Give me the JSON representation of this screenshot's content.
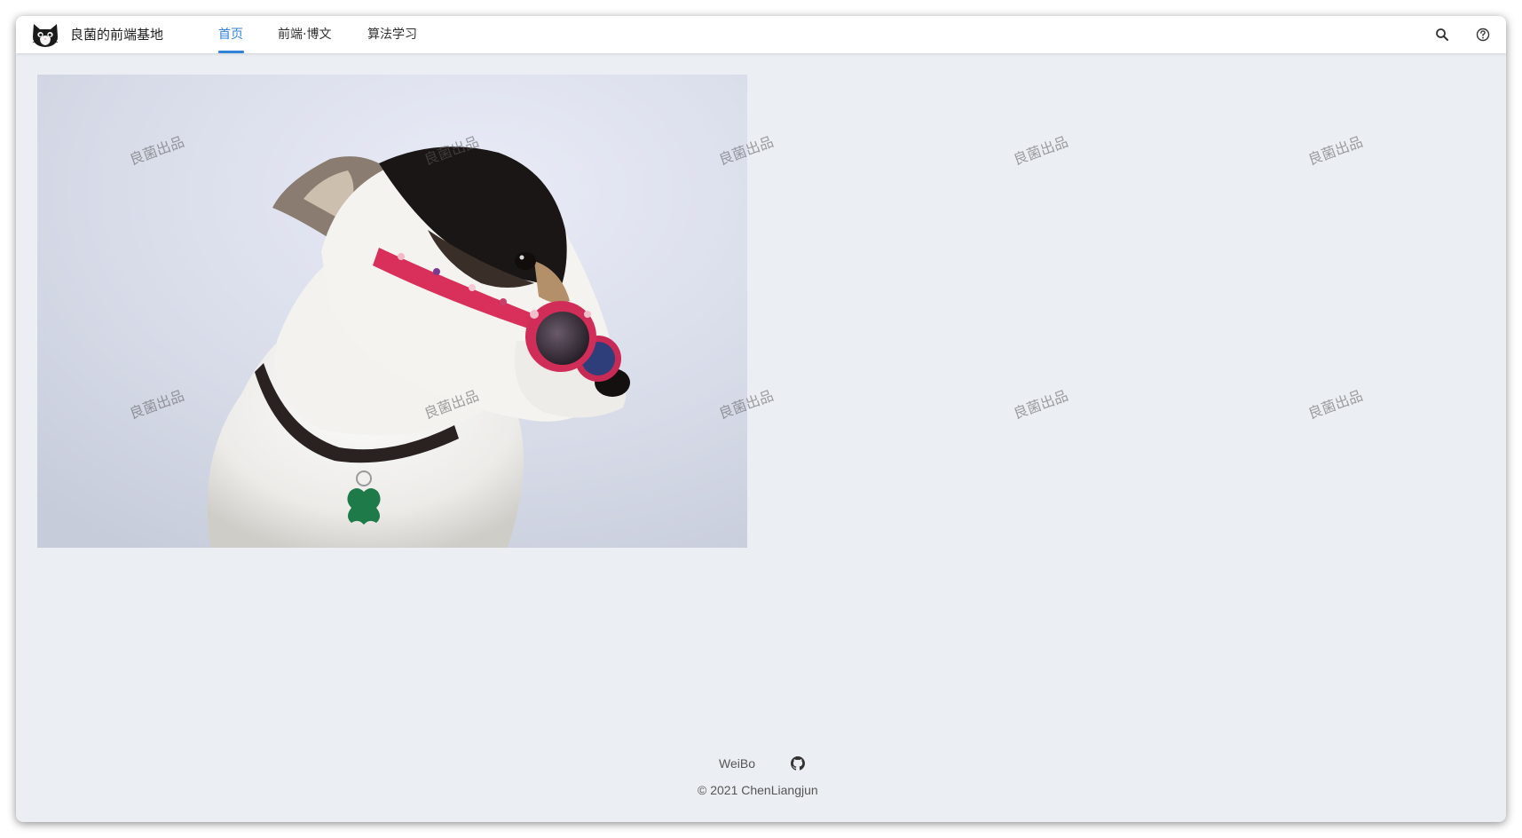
{
  "navbar": {
    "site_title": "良菌的前端基地",
    "logo_icon": "cat-logo-icon",
    "items": [
      {
        "label": "首页",
        "active": true
      },
      {
        "label": "前端·博文",
        "active": false
      },
      {
        "label": "算法学习",
        "active": false
      }
    ],
    "actions": [
      "search-icon",
      "help-icon"
    ],
    "accent": "#2f83d8"
  },
  "main": {
    "hero_image": "dog-wearing-sunglasses-photo",
    "watermark_text": "良菌出品"
  },
  "footer": {
    "link_weibo": "WeiBo",
    "github_icon": "github-icon",
    "copyright_symbol": "©",
    "copyright_text": "2021 ChenLiangjun"
  },
  "colors": {
    "page_bg": "#ebeef3",
    "navbar_bg": "#ffffff"
  }
}
